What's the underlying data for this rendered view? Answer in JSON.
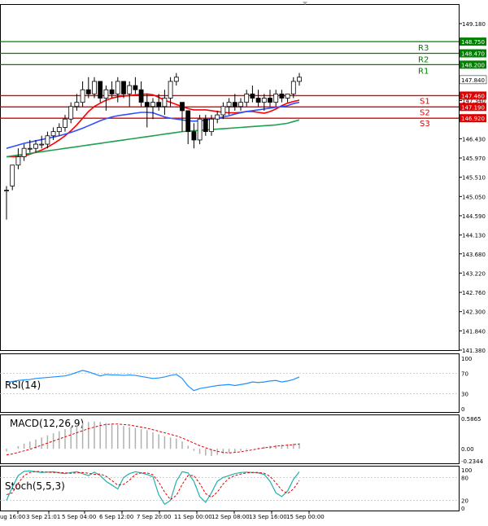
{
  "chart_data": {
    "type": "candlestick",
    "symbol_timeframe": "",
    "main": {
      "y_axis": {
        "ticks": [
          "149.180",
          "148.720",
          "148.260",
          "147.800",
          "147.340",
          "146.880",
          "146.430",
          "145.970",
          "145.510",
          "145.050",
          "144.590",
          "144.130",
          "143.680",
          "143.220",
          "142.760",
          "142.300",
          "141.840",
          "141.380"
        ]
      },
      "x_axis": {
        "labels": [
          "ug 16:00",
          "3 Sep 21:01",
          "5 Sep 04:00",
          "6 Sep 12:00",
          "7 Sep 20:00",
          "11 Sep 00:00",
          "12 Sep 08:00",
          "13 Sep 16:00",
          "15 Sep 00:00"
        ]
      },
      "current_price": "147.840",
      "levels": {
        "resistance": [
          {
            "name": "R3",
            "price": 148.75,
            "label": "148.750"
          },
          {
            "name": "R2",
            "price": 148.47,
            "label": "148.470"
          },
          {
            "name": "R1",
            "price": 148.2,
            "label": "148.200"
          }
        ],
        "support": [
          {
            "name": "S1",
            "price": 147.46,
            "label": "147.460"
          },
          {
            "name": "S2",
            "price": 147.19,
            "label": "147.190"
          },
          {
            "name": "S3",
            "price": 146.92,
            "label": "146.920"
          }
        ],
        "colors": {
          "resistance": "#008000",
          "support": "#e00000"
        }
      },
      "candles": [
        [
          145.2,
          145.3,
          144.5,
          145.2
        ],
        [
          145.3,
          145.8,
          145.2,
          145.8
        ],
        [
          145.8,
          146.2,
          145.7,
          146.0
        ],
        [
          146.0,
          146.3,
          145.9,
          146.2
        ],
        [
          146.2,
          146.4,
          146.1,
          146.2
        ],
        [
          146.2,
          146.4,
          146.1,
          146.3
        ],
        [
          146.3,
          146.5,
          146.2,
          146.3
        ],
        [
          146.3,
          146.6,
          146.2,
          146.5
        ],
        [
          146.5,
          146.7,
          146.4,
          146.6
        ],
        [
          146.6,
          146.8,
          146.5,
          146.7
        ],
        [
          146.7,
          147.0,
          146.6,
          146.9
        ],
        [
          146.9,
          147.3,
          146.8,
          147.2
        ],
        [
          147.2,
          147.5,
          147.1,
          147.3
        ],
        [
          147.3,
          147.8,
          147.2,
          147.6
        ],
        [
          147.6,
          147.9,
          147.4,
          147.5
        ],
        [
          147.5,
          147.9,
          147.4,
          147.8
        ],
        [
          147.8,
          147.8,
          147.3,
          147.4
        ],
        [
          147.4,
          147.7,
          147.1,
          147.6
        ],
        [
          147.6,
          147.8,
          147.4,
          147.5
        ],
        [
          147.5,
          147.9,
          147.3,
          147.8
        ],
        [
          147.8,
          147.8,
          147.4,
          147.5
        ],
        [
          147.5,
          147.8,
          147.2,
          147.7
        ],
        [
          147.7,
          147.9,
          147.5,
          147.6
        ],
        [
          147.6,
          147.8,
          147.2,
          147.3
        ],
        [
          147.3,
          147.5,
          146.7,
          147.2
        ],
        [
          147.2,
          147.4,
          146.9,
          147.3
        ],
        [
          147.3,
          147.5,
          147.1,
          147.2
        ],
        [
          147.2,
          147.6,
          147.0,
          147.4
        ],
        [
          147.4,
          147.9,
          147.2,
          147.8
        ],
        [
          147.8,
          148.0,
          147.7,
          147.9
        ],
        [
          147.3,
          147.3,
          146.6,
          147.1
        ],
        [
          147.1,
          147.1,
          146.3,
          146.6
        ],
        [
          146.6,
          146.8,
          146.2,
          146.4
        ],
        [
          146.4,
          147.0,
          146.3,
          146.9
        ],
        [
          146.9,
          147.0,
          146.5,
          146.6
        ],
        [
          146.6,
          147.0,
          146.5,
          146.9
        ],
        [
          146.9,
          147.1,
          146.8,
          147.0
        ],
        [
          147.0,
          147.3,
          146.9,
          147.2
        ],
        [
          147.2,
          147.4,
          147.0,
          147.3
        ],
        [
          147.3,
          147.5,
          147.1,
          147.2
        ],
        [
          147.2,
          147.4,
          147.1,
          147.3
        ],
        [
          147.3,
          147.6,
          147.2,
          147.5
        ],
        [
          147.5,
          147.7,
          147.3,
          147.4
        ],
        [
          147.4,
          147.6,
          147.2,
          147.3
        ],
        [
          147.3,
          147.5,
          147.1,
          147.4
        ],
        [
          147.4,
          147.6,
          147.2,
          147.3
        ],
        [
          147.3,
          147.6,
          147.2,
          147.5
        ],
        [
          147.5,
          147.6,
          147.3,
          147.4
        ],
        [
          147.4,
          147.5,
          147.3,
          147.5
        ],
        [
          147.5,
          147.9,
          147.4,
          147.8
        ],
        [
          147.8,
          148.0,
          147.7,
          147.9
        ]
      ],
      "moving_averages": [
        {
          "color": "#ff0000",
          "values": [
            146.0,
            146.0,
            146.0,
            146.02,
            146.06,
            146.11,
            146.16,
            146.23,
            146.31,
            146.4,
            146.5,
            146.62,
            146.76,
            146.92,
            147.08,
            147.2,
            147.28,
            147.35,
            147.4,
            147.43,
            147.45,
            147.46,
            147.48,
            147.49,
            147.5,
            147.48,
            147.42,
            147.35,
            147.3,
            147.25,
            147.2,
            147.15,
            147.12,
            147.12,
            147.12,
            147.1,
            147.08,
            147.06,
            147.05,
            147.05,
            147.06,
            147.08,
            147.08,
            147.06,
            147.04,
            147.08,
            147.14,
            147.22,
            147.28,
            147.32,
            147.35
          ]
        },
        {
          "color": "#3050ff",
          "values": [
            146.2,
            146.24,
            146.28,
            146.32,
            146.35,
            146.38,
            146.41,
            146.44,
            146.47,
            146.5,
            146.54,
            146.58,
            146.63,
            146.68,
            146.74,
            146.8,
            146.86,
            146.91,
            146.95,
            146.98,
            147.0,
            147.02,
            147.04,
            147.06,
            147.06,
            147.05,
            147.0,
            146.95,
            146.92,
            146.9,
            146.88,
            146.86,
            146.85,
            146.86,
            146.88,
            146.9,
            146.92,
            146.95,
            146.98,
            147.02,
            147.05,
            147.08,
            147.1,
            147.12,
            147.14,
            147.16,
            147.18,
            147.2,
            147.22,
            147.27,
            147.3
          ]
        },
        {
          "color": "#1fa050",
          "values": [
            146.0,
            146.02,
            146.04,
            146.06,
            146.08,
            146.1,
            146.12,
            146.14,
            146.16,
            146.18,
            146.2,
            146.22,
            146.24,
            146.26,
            146.28,
            146.3,
            146.32,
            146.34,
            146.36,
            146.38,
            146.4,
            146.42,
            146.44,
            146.46,
            146.48,
            146.5,
            146.52,
            146.54,
            146.56,
            146.58,
            146.6,
            146.61,
            146.62,
            146.63,
            146.64,
            146.65,
            146.66,
            146.67,
            146.68,
            146.69,
            146.7,
            146.71,
            146.72,
            146.73,
            146.74,
            146.75,
            146.76,
            146.78,
            146.8,
            146.84,
            146.88
          ]
        }
      ]
    },
    "rsi": {
      "label": "RSI(14)",
      "ticks": [
        "100",
        "70",
        "30",
        "0"
      ],
      "values": [
        52,
        54,
        56,
        57,
        58,
        60,
        61,
        62,
        63,
        64,
        65,
        68,
        72,
        76,
        73,
        69,
        65,
        68,
        67,
        67,
        66,
        67,
        66,
        64,
        62,
        60,
        61,
        63,
        66,
        68,
        60,
        45,
        36,
        40,
        42,
        44,
        46,
        47,
        48,
        46,
        48,
        50,
        53,
        52,
        53,
        55,
        56,
        53,
        55,
        58,
        63
      ]
    },
    "macd": {
      "label": "MACD(12,26,9)",
      "ticks": [
        "0.5865",
        "0.00",
        "-0.2344"
      ],
      "hist": [
        -0.05,
        0.0,
        0.05,
        0.1,
        0.14,
        0.18,
        0.22,
        0.26,
        0.3,
        0.34,
        0.38,
        0.42,
        0.46,
        0.5,
        0.52,
        0.53,
        0.52,
        0.5,
        0.48,
        0.46,
        0.44,
        0.42,
        0.4,
        0.38,
        0.36,
        0.32,
        0.28,
        0.24,
        0.22,
        0.2,
        0.14,
        0.06,
        -0.04,
        -0.1,
        -0.13,
        -0.14,
        -0.12,
        -0.1,
        -0.08,
        -0.06,
        -0.04,
        -0.02,
        0.0,
        0.02,
        0.04,
        0.06,
        0.07,
        0.08,
        0.09,
        0.1,
        0.11
      ],
      "signal": [
        -0.12,
        -0.1,
        -0.07,
        -0.04,
        -0.01,
        0.03,
        0.07,
        0.11,
        0.15,
        0.19,
        0.23,
        0.27,
        0.31,
        0.35,
        0.39,
        0.42,
        0.45,
        0.47,
        0.48,
        0.48,
        0.47,
        0.46,
        0.44,
        0.42,
        0.4,
        0.37,
        0.34,
        0.31,
        0.28,
        0.25,
        0.21,
        0.16,
        0.11,
        0.06,
        0.02,
        -0.02,
        -0.05,
        -0.07,
        -0.08,
        -0.07,
        -0.06,
        -0.04,
        -0.02,
        0.0,
        0.02,
        0.03,
        0.05,
        0.06,
        0.07,
        0.08,
        0.09
      ]
    },
    "stoch": {
      "label": "Stoch(5,5,3)",
      "ticks": [
        "100",
        "80",
        "20",
        "0"
      ],
      "k": [
        20,
        55,
        85,
        96,
        97,
        95,
        93,
        94,
        95,
        92,
        90,
        93,
        95,
        90,
        85,
        94,
        85,
        70,
        60,
        50,
        80,
        90,
        95,
        92,
        88,
        82,
        35,
        10,
        20,
        70,
        95,
        92,
        70,
        30,
        15,
        40,
        70,
        80,
        85,
        90,
        93,
        94,
        93,
        92,
        88,
        70,
        40,
        30,
        45,
        75,
        95
      ],
      "d": [
        35,
        40,
        65,
        85,
        93,
        96,
        95,
        94,
        93,
        93,
        92,
        91,
        92,
        93,
        91,
        88,
        89,
        83,
        72,
        60,
        62,
        73,
        88,
        92,
        92,
        87,
        68,
        42,
        22,
        33,
        62,
        85,
        85,
        64,
        38,
        28,
        42,
        63,
        78,
        85,
        89,
        92,
        93,
        93,
        91,
        83,
        66,
        47,
        38,
        50,
        72
      ]
    }
  }
}
